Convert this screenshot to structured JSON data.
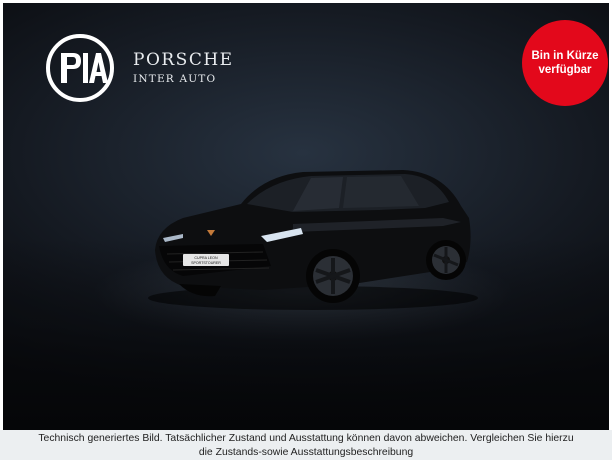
{
  "brand": {
    "title": "PORSCHE",
    "subtitle": "INTER AUTO",
    "logo_icon": "pia-circle-logo-icon"
  },
  "badge": {
    "text": "Bin in Kürze verfügbar",
    "color": "#e3081b"
  },
  "car": {
    "image": "black-station-wagon-image",
    "plate_line1": "CUPRA LEON",
    "plate_line2": "SPORTSTOURER"
  },
  "disclaimer": {
    "line1": "Technisch generiertes Bild. Tatsächlicher Zustand und Ausstattung können davon abweichen. Vergleichen Sie hierzu",
    "line2": "die Zustands-sowie Ausstattungsbeschreibung"
  }
}
